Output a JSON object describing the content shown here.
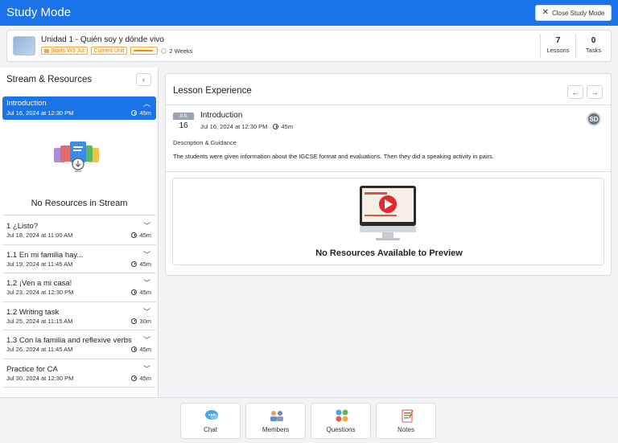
{
  "app": {
    "title": "Study Mode",
    "close_label": "Close Study Mode"
  },
  "unit": {
    "title": "Unidad 1 - Quién soy y dónde vivo",
    "starts_tag": "Starts W3 Jul",
    "current_tag": "Current Unit",
    "progress": 0.9,
    "duration": "2 Weeks",
    "stats": [
      {
        "num": "7",
        "label": "Lessons"
      },
      {
        "num": "0",
        "label": "Tasks"
      }
    ]
  },
  "stream": {
    "header": "Stream & Resources",
    "collapse_icon": "‹",
    "active": {
      "title": "Introduction",
      "date": "Jul 16, 2024 at 12:30 PM",
      "duration": "45m"
    },
    "empty_text": "No Resources in Stream",
    "items": [
      {
        "title": "1 ¿Listo?",
        "date": "Jul 18, 2024 at 11:00 AM",
        "duration": "45m"
      },
      {
        "title": "1.1 En mi familia hay...",
        "date": "Jul 19, 2024 at 11:45 AM",
        "duration": "45m"
      },
      {
        "title": "1.2 ¡Ven a mi casa!",
        "date": "Jul 23, 2024 at 12:30 PM",
        "duration": "45m"
      },
      {
        "title": "1.2 Writing task",
        "date": "Jul 25, 2024 at 11:15 AM",
        "duration": "30m"
      },
      {
        "title": "1.3 Con la familia and reflexive verbs",
        "date": "Jul 26, 2024 at 11:45 AM",
        "duration": "45m"
      },
      {
        "title": "Practice for CA",
        "date": "Jul 30, 2024 at 12:30 PM",
        "duration": "45m"
      }
    ]
  },
  "lesson": {
    "header": "Lesson Experience",
    "month": "JUL",
    "day": "16",
    "title": "Introduction",
    "date": "Jul 16, 2024 at 12:30 PM",
    "duration": "45m",
    "avatar": "SD",
    "desc_heading": "Description & Guidance",
    "desc_text": "The students were given information about the IGCSE format and evaluations. Then they did a speaking activity in pairs.",
    "preview_empty": "No Resources Available to Preview"
  },
  "bottom": [
    {
      "label": "Chat",
      "icon": "chat-icon"
    },
    {
      "label": "Members",
      "icon": "members-icon"
    },
    {
      "label": "Questions",
      "icon": "questions-icon"
    },
    {
      "label": "Notes",
      "icon": "notes-icon"
    }
  ],
  "colors": {
    "primary": "#1a73e8",
    "accent_orange": "#f0a945"
  }
}
